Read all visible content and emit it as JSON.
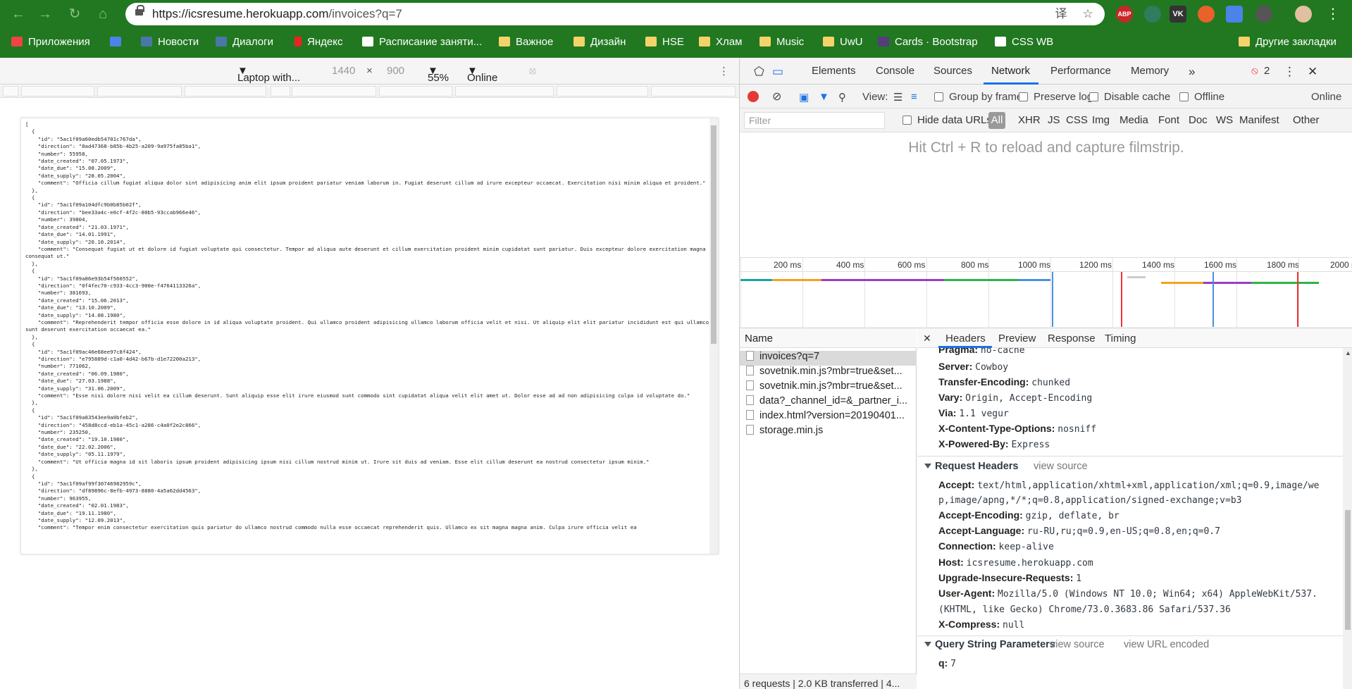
{
  "browser": {
    "url_host": "https://icsresume.herokuapp.com",
    "url_path": "/invoices?q=7",
    "bookmarks": [
      "Приложения",
      "Новости",
      "Диалоги",
      "Яндекс",
      "Расписание заняти...",
      "Важное",
      "Дизайн",
      "HSE",
      "Хлам",
      "Music",
      "UwU",
      "Cards · Bootstrap",
      "CSS WB",
      "Другие закладки"
    ],
    "extensions": [
      "ABP",
      "VK"
    ]
  },
  "device_toolbar": {
    "device": "Laptop with...",
    "width": "1440",
    "times": "×",
    "height": "900",
    "zoom": "55%",
    "throttle": "Online"
  },
  "page_json": "[\n  {\n    \"id\": \"5ac1f09a60edb54701c767da\",\n    \"direction\": \"8ad47368-b85b-4b25-a209-9a975fa85ba1\",\n    \"number\": 55958,\n    \"date_created\": \"07.05.1973\",\n    \"date_due\": \"15.08.2009\",\n    \"date_supply\": \"28.05.2004\",\n    \"comment\": \"Officia cillum fugiat aliqua dolor sint adipisicing anim elit ipsum proident pariatur veniam laborum in. Fugiat deserunt cillum ad irure excepteur occaecat. Exercitation nisi minim aliqua et proident.\"\n  },\n  {\n    \"id\": \"5ac1f09a104dfc9b0b85b02f\",\n    \"direction\": \"bee33a4c-e0cf-4f2c-80b5-93ccab966e46\",\n    \"number\": 39804,\n    \"date_created\": \"21.03.1971\",\n    \"date_due\": \"14.01.1991\",\n    \"date_supply\": \"20.10.2014\",\n    \"comment\": \"Consequat fugiat ut et dolore id fugiat voluptate qui consectetur. Tempor ad aliqua aute deserunt et cillum exercitation proident minim cupidatat sunt pariatur. Duis excepteur dolore exercitation magna consequat ut.\"\n  },\n  {\n    \"id\": \"5ac1f09a86e93b54f560552\",\n    \"direction\": \"0f4fec70-c933-4cc3-900e-f4764113326a\",\n    \"number\": 381693,\n    \"date_created\": \"15.06.2013\",\n    \"date_due\": \"13.10.2009\",\n    \"date_supply\": \"14.08.1980\",\n    \"comment\": \"Reprehenderit tempor officia esse dolore in id aliqua voluptate proident. Qui ullamco proident adipisicing ullamco laborum officia velit et nisi. Ut aliquip elit elit pariatur incididunt est qui ullamco sunt deserunt exercitation occaecat ea.\"\n  },\n  {\n    \"id\": \"5ac1f09ac46e68ee97c8f424\",\n    \"direction\": \"e795889d-c1a0-4d42-b67b-d1e72200a213\",\n    \"number\": 771062,\n    \"date_created\": \"06.09.1980\",\n    \"date_due\": \"27.03.1988\",\n    \"date_supply\": \"31.06.2009\",\n    \"comment\": \"Esse nisi dolore nisi velit ea cillum deserunt. Sunt aliquip esse elit irure eiusmod sunt commodo sint cupidatat aliqua velit elit amet ut. Dolor esse ad ad non adipisicing culpa id voluptate do.\"\n  },\n  {\n    \"id\": \"5ac1f09a83543ee9a0bfeb2\",\n    \"direction\": \"458d8ccd-eb1a-45c1-a286-c4a0f2e2c866\",\n    \"number\": 235250,\n    \"date_created\": \"19.10.1980\",\n    \"date_due\": \"22.02.2006\",\n    \"date_supply\": \"05.11.1979\",\n    \"comment\": \"Ut officia magna id sit laboris ipsum proident adipisicing ipsum nisi cillum nostrud minim ut. Irure sit duis ad veniam. Esse elit cillum deserunt ea nostrud consectetur ipsum minim.\"\n  },\n  {\n    \"id\": \"5ac1f09af99f30746982959c\",\n    \"direction\": \"df89896c-8efb-4973-8880-4a5a62dd4563\",\n    \"number\": 963955,\n    \"date_created\": \"02.01.1983\",\n    \"date_due\": \"19.11.1980\",\n    \"date_supply\": \"12.09.2013\",\n    \"comment\": \"Tempor enim consectetur exercitation quis pariatur do ullamco nostrud commodo nulla esse occaecat reprehenderit quis. Ullamco ex sit magna magna anim. Culpa irure officia velit ea",
  "devtools": {
    "tabs": [
      "Elements",
      "Console",
      "Sources",
      "Network",
      "Performance",
      "Memory"
    ],
    "more": "»",
    "error_count": "2",
    "toolbar": {
      "view_label": "View:",
      "group_by_frame": "Group by frame",
      "preserve_log": "Preserve log",
      "disable_cache": "Disable cache",
      "offline": "Offline",
      "online": "Online"
    },
    "filter": {
      "placeholder": "Filter",
      "hide_data_urls": "Hide data URLs",
      "types": [
        "All",
        "XHR",
        "JS",
        "CSS",
        "Img",
        "Media",
        "Font",
        "Doc",
        "WS",
        "Manifest",
        "Other"
      ]
    },
    "filmstrip_hint": "Hit Ctrl + R to reload and capture filmstrip.",
    "timeline_ticks": [
      "200 ms",
      "400 ms",
      "600 ms",
      "800 ms",
      "1000 ms",
      "1200 ms",
      "1400 ms",
      "1600 ms",
      "1800 ms",
      "2000 r"
    ],
    "name_header": "Name",
    "requests": [
      "invoices?q=7",
      "sovetnik.min.js?mbr=true&set...",
      "sovetnik.min.js?mbr=true&set...",
      "data?_channel_id=&_partner_i...",
      "index.html?version=20190401...",
      "storage.min.js"
    ],
    "status_bar": "6 requests | 2.0 KB transferred | 4...",
    "detail_tabs": [
      "Headers",
      "Preview",
      "Response",
      "Timing"
    ],
    "response_headers": [
      {
        "k": "Pragma:",
        "v": "no-cache"
      },
      {
        "k": "Server:",
        "v": "Cowboy"
      },
      {
        "k": "Transfer-Encoding:",
        "v": "chunked"
      },
      {
        "k": "Vary:",
        "v": "Origin, Accept-Encoding"
      },
      {
        "k": "Via:",
        "v": "1.1 vegur"
      },
      {
        "k": "X-Content-Type-Options:",
        "v": "nosniff"
      },
      {
        "k": "X-Powered-By:",
        "v": "Express"
      }
    ],
    "request_headers_title": "Request Headers",
    "view_source": "view source",
    "request_headers": {
      "accept_key": "Accept:",
      "accept_v1": "text/html,application/xhtml+xml,application/xml;q=0.9,image/we",
      "accept_v2": "p,image/apng,*/*;q=0.8,application/signed-exchange;v=b3",
      "enc_key": "Accept-Encoding:",
      "enc_v": "gzip, deflate, br",
      "lang_key": "Accept-Language:",
      "lang_v": "ru-RU,ru;q=0.9,en-US;q=0.8,en;q=0.7",
      "conn_key": "Connection:",
      "conn_v": "keep-alive",
      "host_key": "Host:",
      "host_v": "icsresume.herokuapp.com",
      "uir_key": "Upgrade-Insecure-Requests:",
      "uir_v": "1",
      "ua_key": "User-Agent:",
      "ua_v1": "Mozilla/5.0 (Windows NT 10.0; Win64; x64) AppleWebKit/537.",
      "ua_v2": "(KHTML, like Gecko) Chrome/73.0.3683.86 Safari/537.36",
      "xc_key": "X-Compress:",
      "xc_v": "null"
    },
    "qsp_title": "Query String Parameters",
    "view_url_encoded": "view URL encoded",
    "qsp": {
      "k": "q:",
      "v": "7"
    }
  }
}
